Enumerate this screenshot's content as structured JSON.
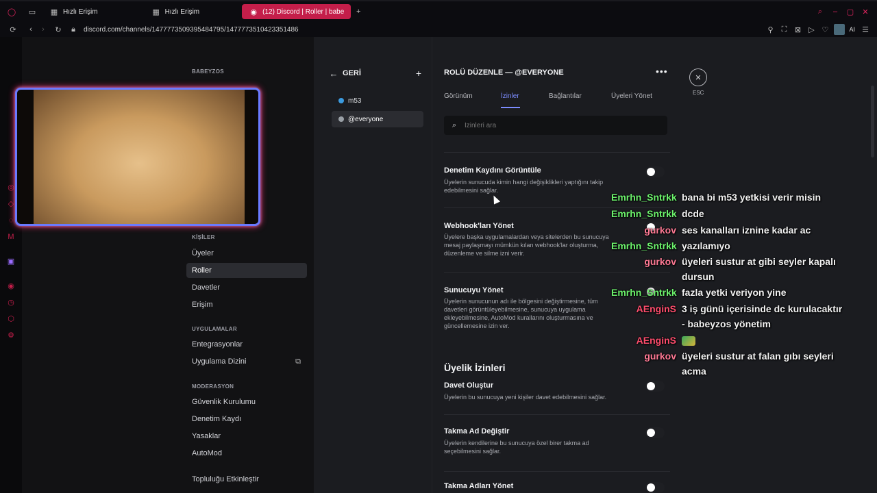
{
  "browser": {
    "tabs": [
      {
        "label": "Hızlı Erişim"
      },
      {
        "label": "Hızlı Erişim"
      },
      {
        "label": "(12) Discord | Roller | babe"
      }
    ],
    "url": "discord.com/channels/1477773509395484795/1477773510423351486",
    "ai_label": "AI"
  },
  "server_name": "BABEYZOS",
  "nav": {
    "people_header": "KİŞİLER",
    "people": [
      "Üyeler",
      "Roller",
      "Davetler",
      "Erişim"
    ],
    "apps_header": "UYGULAMALAR",
    "apps": [
      "Entegrasyonlar",
      "Uygulama Dizini"
    ],
    "mod_header": "MODERASYON",
    "mod": [
      "Güvenlik Kurulumu",
      "Denetim Kaydı",
      "Yasaklar",
      "AutoMod"
    ],
    "community": "Topluluğu Etkinleştir"
  },
  "roles_panel": {
    "back_label": "GERİ",
    "roles": [
      {
        "name": "m53",
        "color": "#3b9be0"
      },
      {
        "name": "@everyone",
        "color": "#9aa0a6"
      }
    ]
  },
  "edit": {
    "title": "ROLÜ DÜZENLE — @EVERYONE",
    "tabs": [
      "Görünüm",
      "İzinler",
      "Bağlantılar",
      "Üyeleri Yönet"
    ],
    "active_tab": "İzinler",
    "search_placeholder": "İzinleri ara",
    "close_label": "ESC",
    "permissions": [
      {
        "title": "Denetim Kaydını Görüntüle",
        "desc": "Üyelerin sunucuda kimin hangi değişiklikleri yaptığını takip edebilmesini sağlar."
      },
      {
        "title": "Webhook'ları Yönet",
        "desc": "Üyelere başka uygulamalardan veya sitelerden bu sunucuya mesaj paylaşmayı mümkün kılan webhook'lar oluşturma, düzenleme ve silme izni verir."
      },
      {
        "title": "Sunucuyu Yönet",
        "desc": "Üyelerin sunucunun adı ile bölgesini değiştirmesine, tüm davetleri görüntüleyebilmesine, sunucuya uygulama ekleyebilmesine, AutoMod kurallarını oluşturmasına ve güncellemesine izin ver."
      }
    ],
    "membership_header": "Üyelik İzinleri",
    "membership": [
      {
        "title": "Davet Oluştur",
        "desc": "Üyelerin bu sunucuya yeni kişiler davet edebilmesini sağlar."
      },
      {
        "title": "Takma Ad Değiştir",
        "desc": "Üyelerin kendilerine bu sunucuya özel birer takma ad seçebilmesini sağlar."
      },
      {
        "title": "Takma Adları Yönet",
        "desc": ""
      }
    ]
  },
  "stream_chat": [
    {
      "user": "Emrhn_Sntrkk",
      "msg": "bana bi m53 yetkisi verir misin",
      "color": "#6cf26c"
    },
    {
      "user": "Emrhn_Sntrkk",
      "msg": "dcde",
      "color": "#6cf26c"
    },
    {
      "user": "gurkov",
      "msg": "ses kanalları iznine kadar ac",
      "color": "#ff7a95"
    },
    {
      "user": "Emrhn_Sntrkk",
      "msg": "yazılamıyo",
      "color": "#6cf26c"
    },
    {
      "user": "gurkov",
      "msg": "üyeleri sustur at gibi seyler kapalı",
      "msg2": "dursun",
      "color": "#ff7a95"
    },
    {
      "user": "Emrhn_Sntrkk",
      "msg": "fazla yetki veriyon yine",
      "color": "#6cf26c"
    },
    {
      "user": "AEnginS",
      "msg": "3 iş günü içerisinde dc kurulacaktır",
      "msg2": "- babeyzos yönetim",
      "color": "#ff4d6d"
    },
    {
      "user": "AEnginS",
      "msg": "",
      "color": "#ff4d6d"
    },
    {
      "user": "gurkov",
      "msg": "üyeleri sustur at falan gıbı seyleri",
      "msg2": "acma",
      "color": "#ff7a95"
    }
  ]
}
